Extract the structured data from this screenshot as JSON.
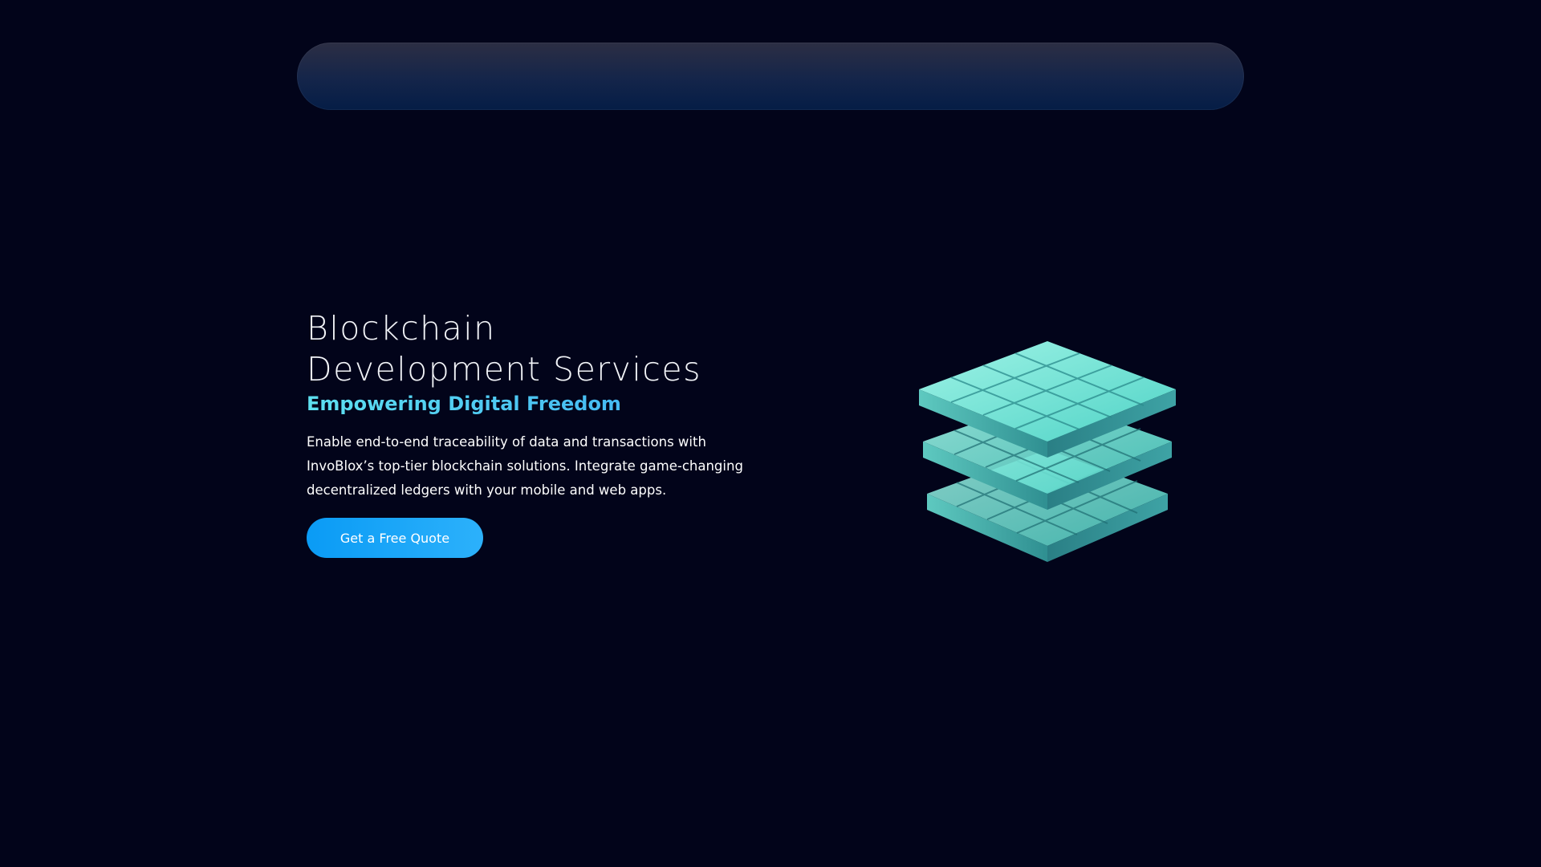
{
  "hero": {
    "title_line1": "Blockchain",
    "title_line2": "Development Services",
    "subtitle": "Empowering Digital Freedom",
    "description": "Enable end-to-end traceability of data and transactions with InvoBlox’s top-tier blockchain solutions. Integrate game-changing decentralized ledgers with your mobile and web apps.",
    "cta_label": "Get a Free Quote"
  },
  "illustration": {
    "icon": "stacked-blocks-icon",
    "color": "#5fdccf"
  },
  "colors": {
    "background": "#02041a",
    "accent": "#1aa6f7",
    "subtitle": "#41b9f2"
  }
}
